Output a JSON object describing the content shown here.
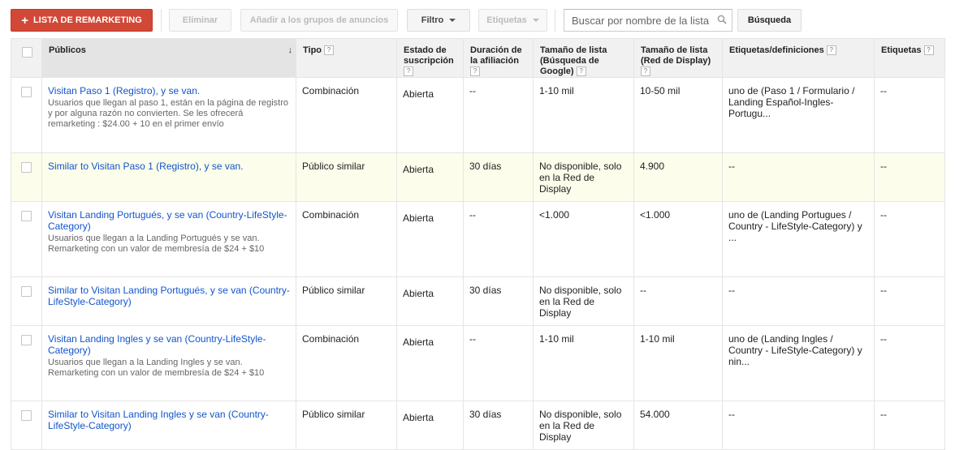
{
  "toolbar": {
    "add_label": "LISTA DE REMARKETING",
    "delete_label": "Eliminar",
    "add_to_groups_label": "Añadir a los grupos de anuncios",
    "filter_label": "Filtro",
    "labels_label": "Etiquetas",
    "search_placeholder": "Buscar por nombre de la lista",
    "search_button": "Búsqueda"
  },
  "table": {
    "headers": {
      "publicos": "Públicos",
      "tipo": "Tipo",
      "estado": "Estado de suscripción",
      "duracion": "Duración de la afiliación",
      "tam_busqueda": "Tamaño de lista (Búsqueda de Google)",
      "tam_display": "Tamaño de lista (Red de Display)",
      "etiquetas_def": "Etiquetas/definiciones",
      "etiquetas": "Etiquetas"
    },
    "help_glyph": "?",
    "sort_arrow": "↓",
    "rows": [
      {
        "name": "Visitan Paso 1 (Registro), y se van.",
        "desc": "Usuarios que llegan al paso 1, están en la página de registro y por alguna razón no convierten. Se les ofrecerá remarketing : $24.00 + 10 en el primer envío",
        "tipo": "Combinación",
        "estado": "Abierta",
        "duracion": "--",
        "tam_busqueda": "1-10 mil",
        "tam_display": "10-50 mil",
        "etiquetas_def": "uno de (Paso 1 / Formulario / Landing Español-Ingles-Portugu...",
        "etiquetas": "--"
      },
      {
        "name": "Similar to Visitan Paso 1 (Registro), y se van.",
        "desc": "",
        "tipo": "Público similar",
        "estado": "Abierta",
        "duracion": "30 días",
        "tam_busqueda": "No disponible, solo en la Red de Display",
        "tam_display": "4.900",
        "etiquetas_def": "--",
        "etiquetas": "--"
      },
      {
        "name": "Visitan Landing Portugués, y se van (Country-LifeStyle-Category)",
        "desc": "Usuarios que llegan a la Landing Portugués y se van. Remarketing con un valor de membresía de $24 + $10",
        "tipo": "Combinación",
        "estado": "Abierta",
        "duracion": "--",
        "tam_busqueda": "<1.000",
        "tam_display": "<1.000",
        "etiquetas_def": "uno de (Landing Portugues / Country - LifeStyle-Category) y ...",
        "etiquetas": "--"
      },
      {
        "name": "Similar to Visitan Landing Portugués, y se van (Country-LifeStyle-Category)",
        "desc": "",
        "tipo": "Público similar",
        "estado": "Abierta",
        "duracion": "30 días",
        "tam_busqueda": "No disponible, solo en la Red de Display",
        "tam_display": "--",
        "etiquetas_def": "--",
        "etiquetas": "--"
      },
      {
        "name": "Visitan Landing Ingles y se van (Country-LifeStyle-Category)",
        "desc": "Usuarios que llegan a la Landing Ingles y se van. Remarketing con un valor de membresía de $24 + $10",
        "tipo": "Combinación",
        "estado": "Abierta",
        "duracion": "--",
        "tam_busqueda": "1-10 mil",
        "tam_display": "1-10 mil",
        "etiquetas_def": "uno de (Landing Ingles / Country - LifeStyle-Category) y nin...",
        "etiquetas": "--"
      },
      {
        "name": "Similar to Visitan Landing Ingles y se van (Country-LifeStyle-Category)",
        "desc": "",
        "tipo": "Público similar",
        "estado": "Abierta",
        "duracion": "30 días",
        "tam_busqueda": "No disponible, solo en la Red de Display",
        "tam_display": "54.000",
        "etiquetas_def": "--",
        "etiquetas": "--"
      }
    ]
  },
  "colors": {
    "primary_button": "#d14836",
    "link": "#1155cc",
    "highlight_row": "#fcfdeb"
  }
}
